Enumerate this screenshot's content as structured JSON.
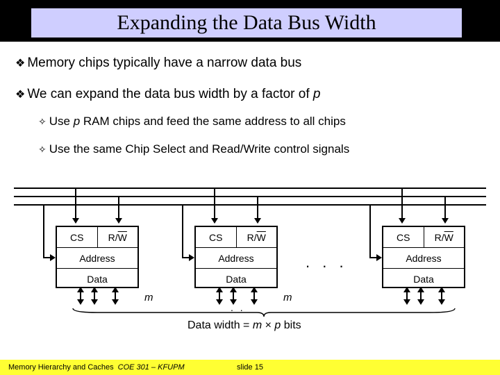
{
  "title": "Expanding the Data Bus Width",
  "bullets": {
    "b1": "Memory chips typically have a narrow data bus",
    "b2_pre": "We can expand the data bus width by a factor of ",
    "b2_var": "p",
    "s1_pre": "Use ",
    "s1_var": "p",
    "s1_post": " RAM chips and feed the same address to all chips",
    "s2": "Use the same Chip Select and Read/Write control signals"
  },
  "chip": {
    "cs": "CS",
    "rw_r": "R/",
    "rw_w": "W",
    "addr": "Address",
    "data": "Data"
  },
  "dots": ". . .",
  "dots2": ". .",
  "m": "m",
  "caption_pre": "Data width = ",
  "caption_m": "m",
  "caption_mid": " × ",
  "caption_p": "p",
  "caption_post": " bits",
  "footer": {
    "left": "Memory Hierarchy and Caches",
    "course": "COE 301 – KFUPM",
    "slide": "slide 15"
  }
}
